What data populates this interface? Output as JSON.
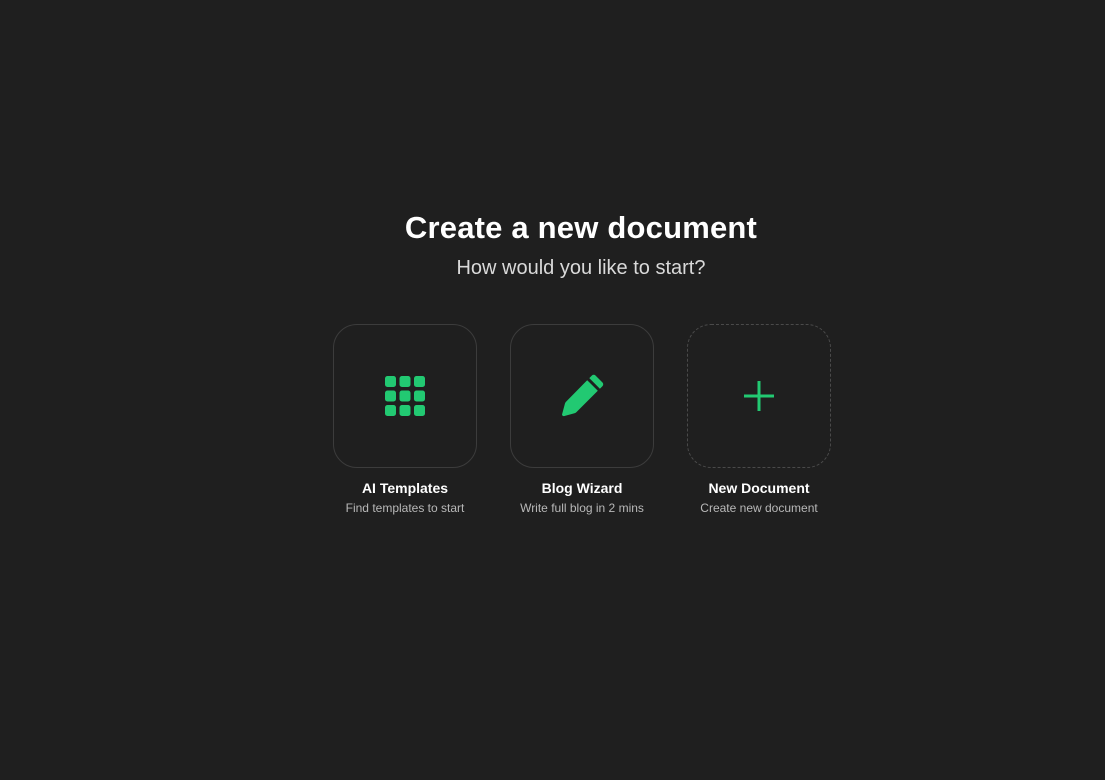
{
  "header": {
    "title": "Create a new document",
    "subtitle": "How would you like to start?"
  },
  "accent_color": "#22c972",
  "options": [
    {
      "label": "AI Templates",
      "description": "Find templates to start",
      "icon": "grid-icon"
    },
    {
      "label": "Blog Wizard",
      "description": "Write full blog in 2 mins",
      "icon": "pencil-icon"
    },
    {
      "label": "New Document",
      "description": "Create new document",
      "icon": "plus-icon"
    }
  ]
}
